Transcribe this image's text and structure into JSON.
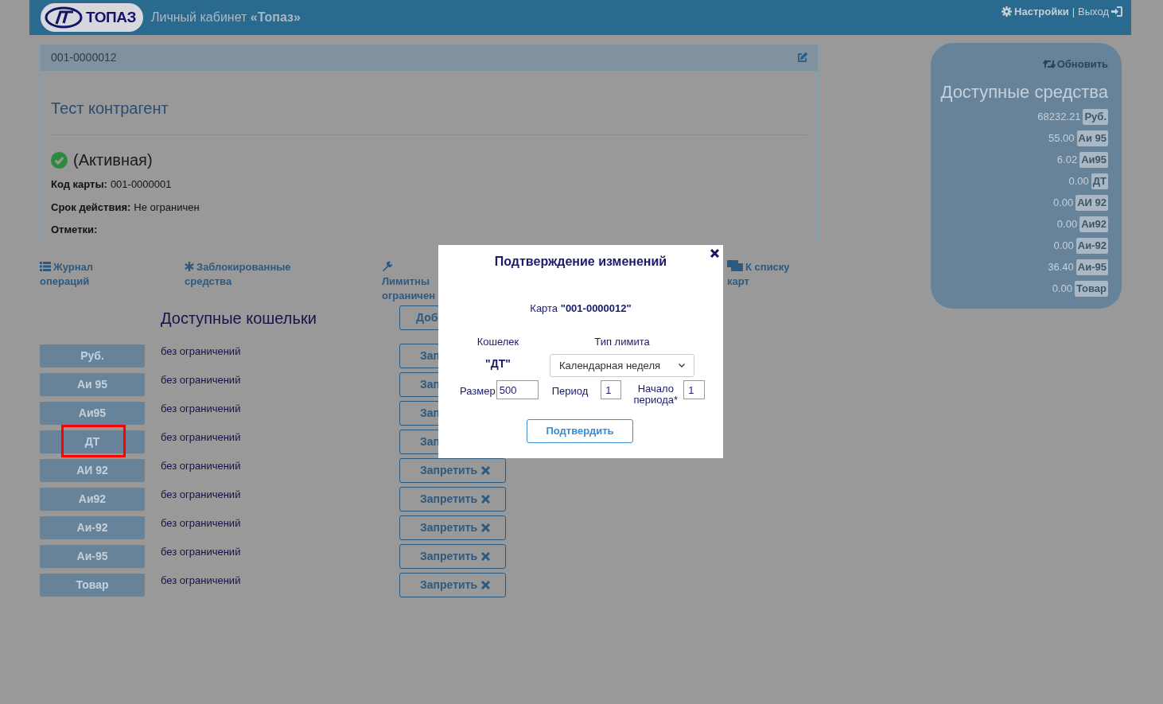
{
  "header": {
    "logo_text": "ТОПАЗ",
    "title": "Личный кабинет **«Топаз»**",
    "settings": "Настройки",
    "separator": "|",
    "logout": "Выход"
  },
  "card": {
    "number": "001-0000012",
    "name": "Тест контрагент",
    "active": true,
    "status": "(Активная)",
    "fields": [
      {
        "label": "Код карты:",
        "value": "001-0000001"
      },
      {
        "label": "Срок действия:",
        "value": "Не ограничен"
      },
      {
        "label": "Отметки:"
      }
    ]
  },
  "nav": [
    {
      "kind": "list",
      "label": "Журнал операций"
    },
    {
      "kind": "asterisk",
      "label": "Заблокированные средства"
    },
    {
      "kind": "wrench",
      "label": "Лимитны ограничен"
    },
    {
      "kind": "cards",
      "label": "К списку карт"
    }
  ],
  "wallets": {
    "title": "Доступные кошельки",
    "add_button": "Доб",
    "rows": [
      {
        "label": "Руб.",
        "limit": "без ограничений",
        "action": "Зап",
        "highlighted": false
      },
      {
        "label": "Аи 95",
        "limit": "без ограничений",
        "action": "Зап",
        "highlighted": false
      },
      {
        "label": "Аи95",
        "limit": "без ограничений",
        "action": "Зап",
        "highlighted": false
      },
      {
        "label": "ДТ",
        "limit": "без ограничений",
        "action": "Зап",
        "highlighted": true
      },
      {
        "label": "АИ 92",
        "limit": "без ограничений",
        "action": "Запретить",
        "highlighted": false
      },
      {
        "label": "Аи92",
        "limit": "без ограничений",
        "action": "Запретить",
        "highlighted": false
      },
      {
        "label": "Аи-92",
        "limit": "без ограничений",
        "action": "Запретить",
        "highlighted": false
      },
      {
        "label": "Аи-95",
        "limit": "без ограничений",
        "action": "Запретить",
        "highlighted": false
      },
      {
        "label": "Товар",
        "limit": "без ограничений",
        "action": "Запретить",
        "highlighted": false
      }
    ]
  },
  "funds": {
    "refresh": "Обновить",
    "title": "Доступные средства",
    "balances": [
      {
        "amount": "68232.21",
        "unit": "Руб."
      },
      {
        "amount": "55.00",
        "unit": "Аи 95"
      },
      {
        "amount": "6.02",
        "unit": "Аи95"
      },
      {
        "amount": "0.00",
        "unit": "ДТ"
      },
      {
        "amount": "0.00",
        "unit": "АИ 92"
      },
      {
        "amount": "0.00",
        "unit": "Аи92"
      },
      {
        "amount": "0.00",
        "unit": "Аи-92"
      },
      {
        "amount": "36.40",
        "unit": "Аи-95"
      },
      {
        "amount": "0.00",
        "unit": "Товар"
      }
    ]
  },
  "modal": {
    "title": "Подтверждение изменений",
    "card_text": "Карта **\"001-0000012\"**",
    "wallet_label": "Кошелек",
    "limit_type_label": "Тип лимита",
    "wallet_value": "\"ДТ\"",
    "limit_type_value": "Календарная неделя",
    "size_label": "Размер",
    "size_value": "500",
    "period_label": "Период",
    "period_value": "1",
    "start_label": "Начало периода*",
    "start_value": "1",
    "confirm": "Подтвердить"
  }
}
